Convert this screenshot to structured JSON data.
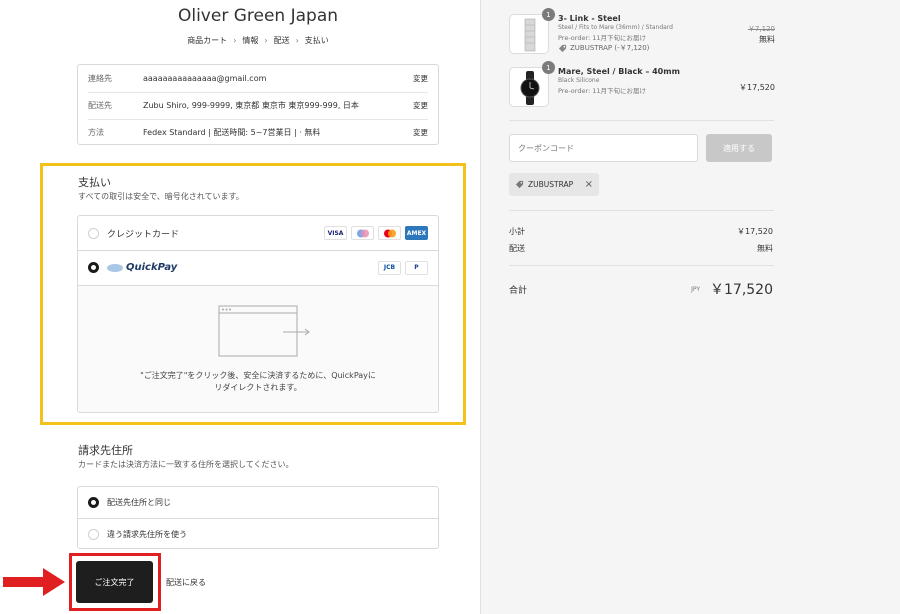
{
  "shop": {
    "name": "Oliver Green Japan"
  },
  "breadcrumb": [
    "商品カート",
    "情報",
    "配送",
    "支払い"
  ],
  "review": {
    "rows": [
      {
        "label": "連絡先",
        "value": "aaaaaaaaaaaaaaa@gmail.com",
        "change": "変更"
      },
      {
        "label": "配送先",
        "value": "Zubu Shiro, 999-9999, 東京都 東京市 東京999-999, 日本",
        "change": "変更"
      },
      {
        "label": "方法",
        "value": "Fedex Standard | 配送時間: 5~7営業日 | · 無料",
        "change": "変更"
      }
    ]
  },
  "payment": {
    "title": "支払い",
    "subtitle": "すべての取引は安全で、暗号化されています。",
    "options": [
      {
        "label": "クレジットカード",
        "selected": false,
        "cards": [
          "VISA",
          "MC",
          "MC",
          "AMEX"
        ]
      },
      {
        "label": "QuickPay",
        "selected": true,
        "cards": [
          "JCB",
          "P"
        ]
      }
    ],
    "redirect_text_line1": "\"ご注文完了\"をクリック後、安全に決済するために、QuickPayに",
    "redirect_text_line2": "リダイレクトされます。"
  },
  "billing": {
    "title": "請求先住所",
    "subtitle": "カードまたは決済方法に一致する住所を選択してください。",
    "options": [
      {
        "label": "配送先住所と同じ",
        "selected": true
      },
      {
        "label": "違う請求先住所を使う",
        "selected": false
      }
    ]
  },
  "actions": {
    "complete": "ご注文完了",
    "back": "配送に戻る"
  },
  "order": {
    "items": [
      {
        "qty": "1",
        "name": "3- Link - Steel",
        "variant": "Steel / Fits to Mare (36mm) / Standard",
        "preorder": "Pre-order: 11月下旬にお届け",
        "discount": "ZUBUSTRAP (-￥7,120)",
        "original_price": "￥7,120",
        "price": "無料"
      },
      {
        "qty": "1",
        "name": "Mare, Steel / Black – 40mm",
        "variant": "Black Silicone",
        "preorder": "Pre-order: 11月下旬にお届け",
        "price": "￥17,520"
      }
    ],
    "coupon_placeholder": "クーポンコード",
    "apply_label": "適用する",
    "applied_code": "ZUBUSTRAP",
    "subtotal_label": "小計",
    "subtotal": "￥17,520",
    "shipping_label": "配送",
    "shipping": "無料",
    "total_label": "合計",
    "currency": "JPY",
    "total": "￥17,520"
  },
  "colors": {
    "highlight": "#f3c21a",
    "red": "#e02020",
    "button": "#1e1e1e"
  }
}
